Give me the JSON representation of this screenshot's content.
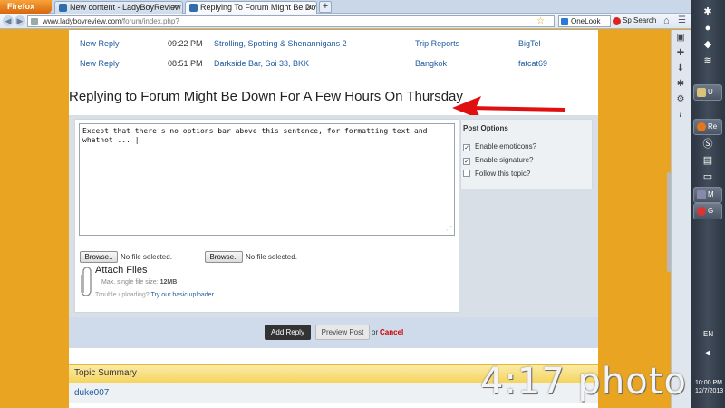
{
  "browser": {
    "app_button": "Firefox",
    "tabs": [
      {
        "label": "New content - LadyBoyReview"
      },
      {
        "label": "Replying To Forum Might Be Down F..."
      }
    ],
    "new_tab_symbol": "+",
    "url_host": "www.ladyboyreview.com",
    "url_path": "/forum/index.php?",
    "onelook_label": "OneLook",
    "spsearch_label": "Sp Search"
  },
  "recent_topics": [
    {
      "action": "New Reply",
      "time": "09:22 PM",
      "topic": "Strolling, Spotting & Shenannigans 2",
      "forum": "Trip Reports",
      "user": "BigTel"
    },
    {
      "action": "New Reply",
      "time": "08:51 PM",
      "topic": "Darkside Bar, Soi 33, BKK",
      "forum": "Bangkok",
      "user": "fatcat69"
    }
  ],
  "reply": {
    "heading": "Replying to Forum Might Be Down For A Few Hours On Thursday",
    "editor_text": "Except that there's no options bar above this sentence, for formatting text and\nwhatnot ... |"
  },
  "attachments": {
    "browse_label": "Browse..",
    "no_file_text": "No file selected.",
    "title": "Attach Files",
    "max_size_label": "Max. single file size:",
    "max_size_value": "12MB",
    "trouble_text": "Trouble uploading?",
    "basic_uploader_link": "Try our basic uploader"
  },
  "post_options": {
    "title": "Post Options",
    "items": [
      {
        "label": "Enable emoticons?",
        "checked": true
      },
      {
        "label": "Enable signature?",
        "checked": true
      },
      {
        "label": "Follow this topic?",
        "checked": false
      }
    ]
  },
  "actions": {
    "add_reply": "Add Reply",
    "preview_post": "Preview Post",
    "or_text": "or",
    "cancel": "Cancel"
  },
  "topic_summary": {
    "title": "Topic Summary",
    "first_user": "duke007"
  },
  "taskbar": {
    "items": [
      "U",
      "Re",
      "M",
      "G"
    ],
    "language": "EN",
    "clock_time": "10:00 PM",
    "clock_date": "12/7/2013"
  },
  "watermark": "4:17 photo",
  "colors": {
    "page_background": "#e9a521",
    "link": "#1e5aa0",
    "cancel": "#cc0000",
    "annotation_arrow": "#e01010"
  }
}
